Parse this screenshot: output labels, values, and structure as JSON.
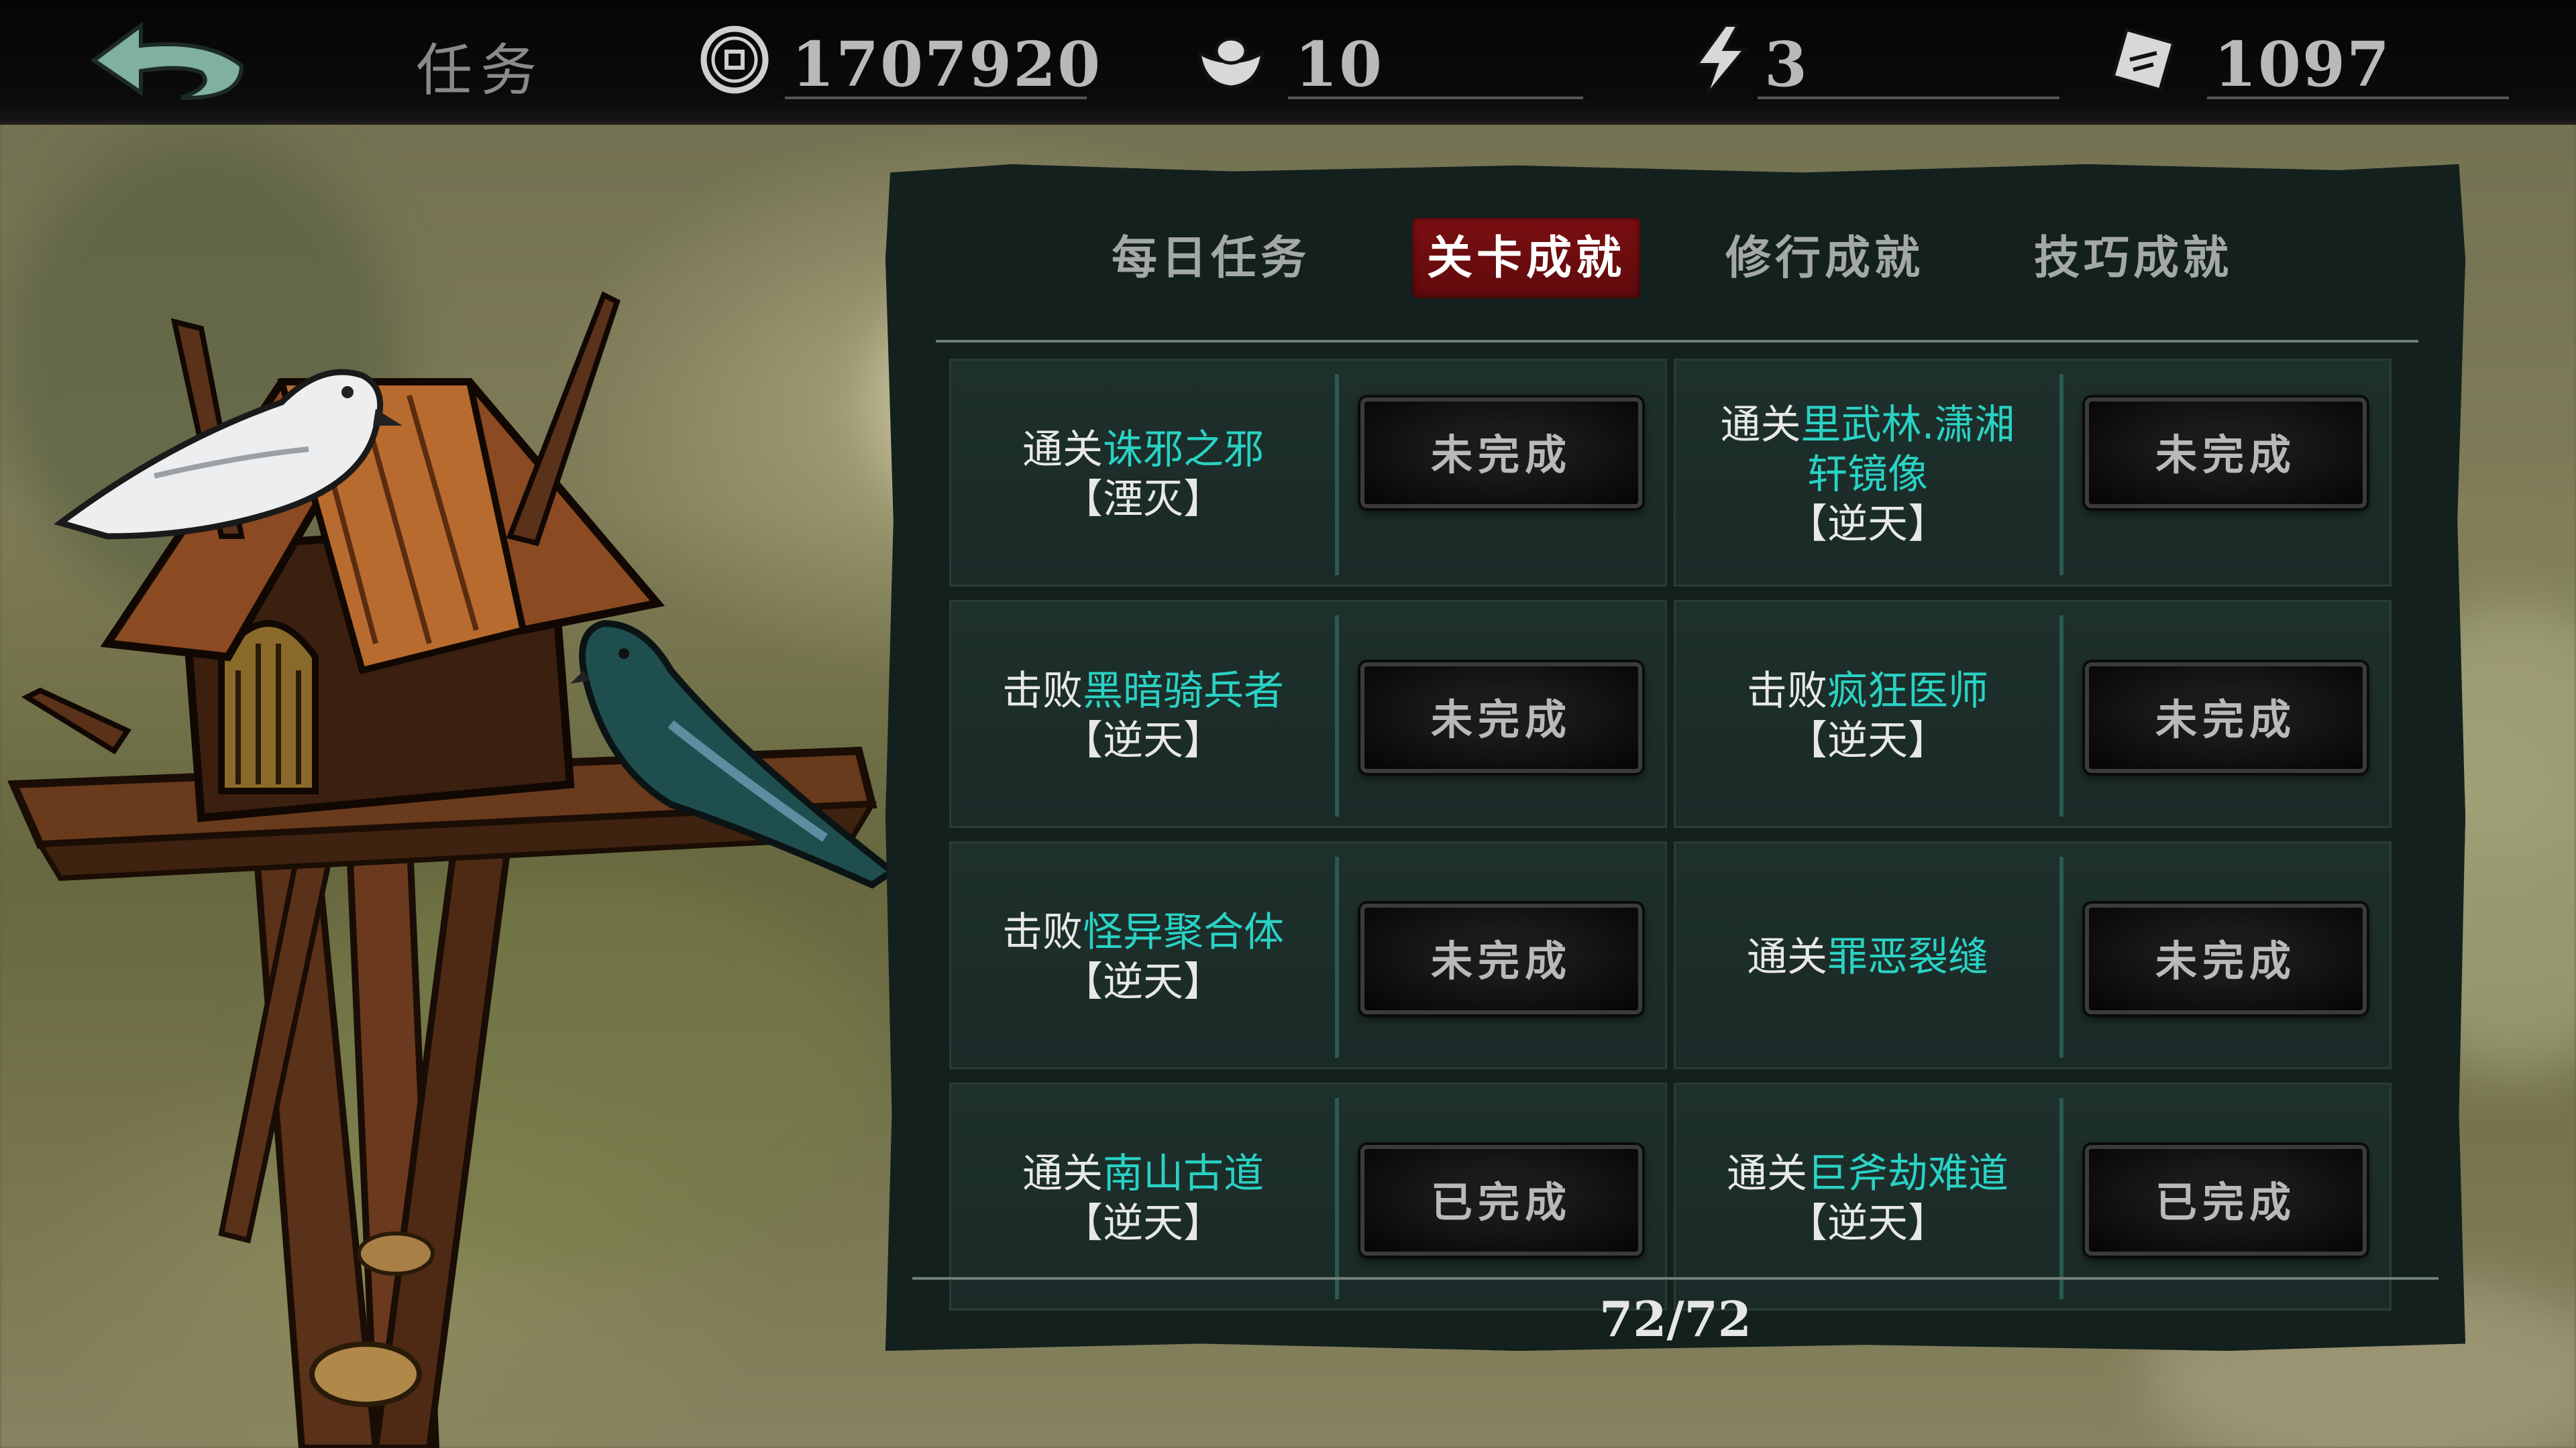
{
  "header": {
    "title": "任务",
    "coins": "1707920",
    "ingots": "10",
    "energy": "3",
    "tickets": "1097"
  },
  "tabs": [
    {
      "label": "每日任务",
      "active": false
    },
    {
      "label": "关卡成就",
      "active": true
    },
    {
      "label": "修行成就",
      "active": false
    },
    {
      "label": "技巧成就",
      "active": false
    }
  ],
  "achievements": [
    {
      "prefix": "通关",
      "target": "诛邪之邪",
      "difficulty": "【湮灭】",
      "status": "未完成"
    },
    {
      "prefix": "通关",
      "target": "里武林.潇湘轩镜像",
      "difficulty": "【逆天】",
      "status": "未完成"
    },
    {
      "prefix": "击败",
      "target": "黑暗骑兵者",
      "difficulty": "【逆天】",
      "status": "未完成"
    },
    {
      "prefix": "击败",
      "target": "疯狂医师",
      "difficulty": "【逆天】",
      "status": "未完成"
    },
    {
      "prefix": "击败",
      "target": "怪异聚合体",
      "difficulty": "【逆天】",
      "status": "未完成"
    },
    {
      "prefix": "通关",
      "target": "罪恶裂缝",
      "difficulty": "",
      "status": "未完成"
    },
    {
      "prefix": "通关",
      "target": "南山古道",
      "difficulty": "【逆天】",
      "status": "已完成"
    },
    {
      "prefix": "通关",
      "target": "巨斧劫难道",
      "difficulty": "【逆天】",
      "status": "已完成"
    }
  ],
  "pager": "72/72",
  "colors": {
    "highlight": "#2ad2c4",
    "active_tab": "#7b0f12",
    "panel_bg": "#13201d"
  }
}
